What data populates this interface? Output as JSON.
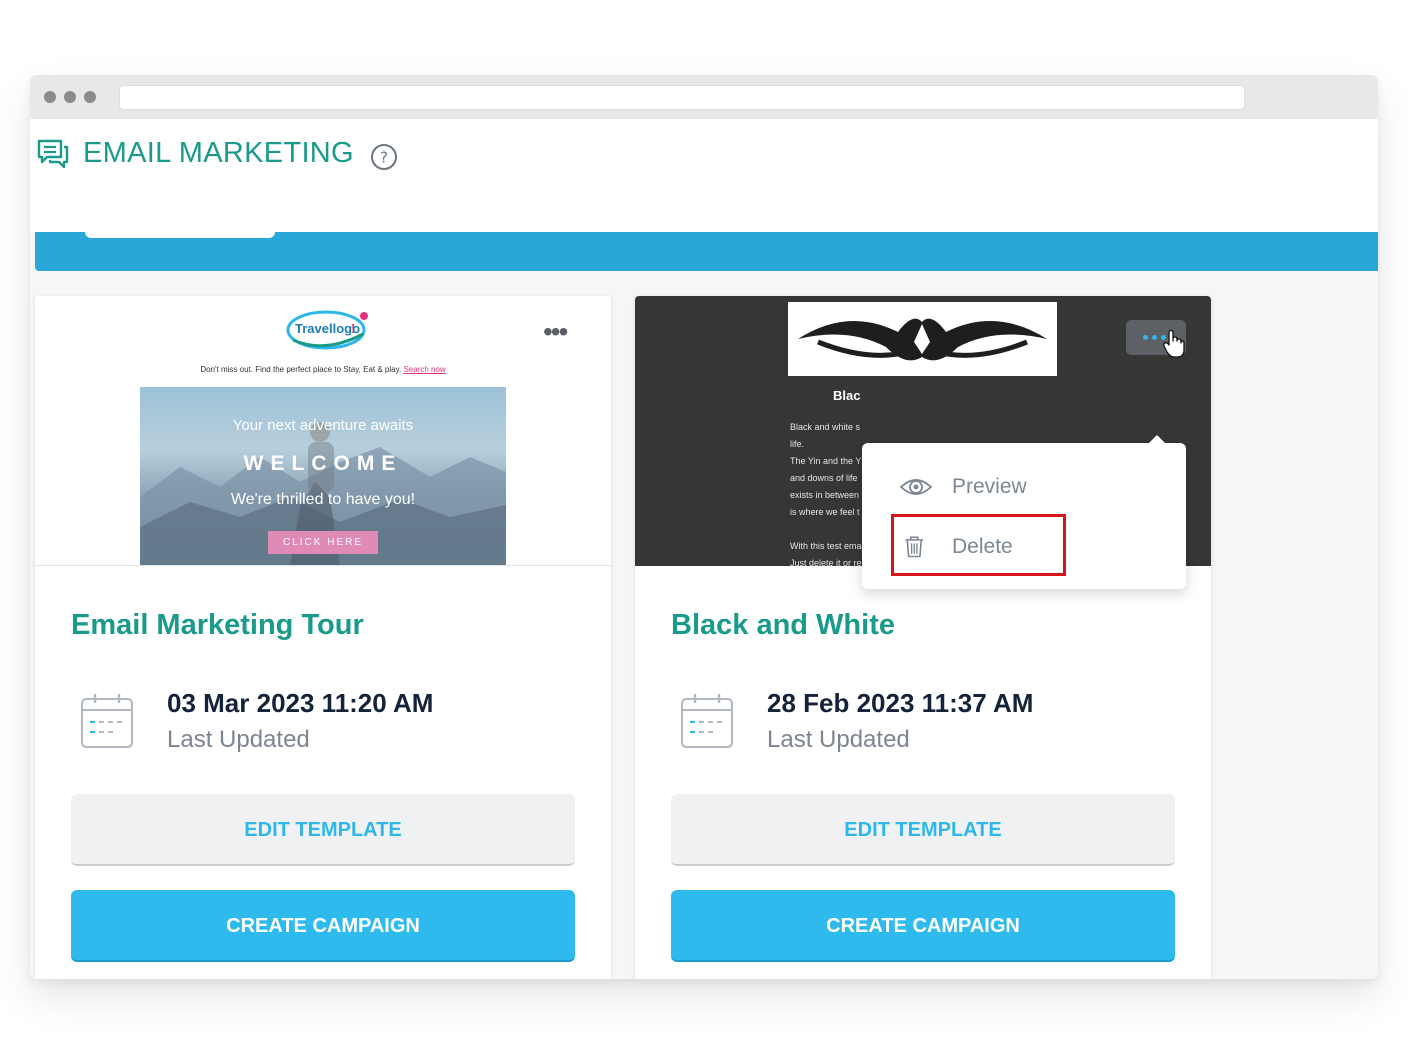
{
  "header": {
    "title": "EMAIL MARKETING",
    "help_icon": "question-circle-icon",
    "chat_icon": "chat-bubbles-icon"
  },
  "cards": [
    {
      "name": "Email Marketing Tour",
      "date": "03 Mar 2023 11:20 AM",
      "date_label": "Last Updated",
      "edit_label": "EDIT TEMPLATE",
      "create_label": "CREATE CAMPAIGN",
      "preview": {
        "logo_text": "Travellogo!",
        "tagline": "Don't miss out. Find the perfect place to Stay, Eat & play.",
        "tagline_link": "Search now",
        "hero_line1": "Your next adventure awaits",
        "hero_line2": "WELCOME",
        "hero_line3": "We're thrilled to have you!",
        "hero_button": "CLICK HERE"
      }
    },
    {
      "name": "Black and White",
      "date": "28 Feb 2023 11:37 AM",
      "date_label": "Last Updated",
      "edit_label": "EDIT TEMPLATE",
      "create_label": "CREATE CAMPAIGN",
      "preview": {
        "title_fragment": "Blac",
        "lines": [
          "Black and white s",
          "life.",
          "The Yin and the Y",
          "and downs of life",
          "exists in between",
          "is where we feel t"
        ],
        "line_after_1": "With this test email, I know that you also didn't expect this.",
        "line_after_2": "Just delete it or reply that you receive this for analysis. Thank"
      }
    }
  ],
  "dropdown": {
    "items": [
      {
        "label": "Preview",
        "icon": "eye-icon"
      },
      {
        "label": "Delete",
        "icon": "trash-icon"
      }
    ],
    "highlighted_item": "Delete",
    "highlight_color": "#d6121a"
  },
  "colors": {
    "accent_teal": "#1a9a8b",
    "brand_blue": "#2fbaee",
    "banner_blue": "#2aa7d9"
  }
}
